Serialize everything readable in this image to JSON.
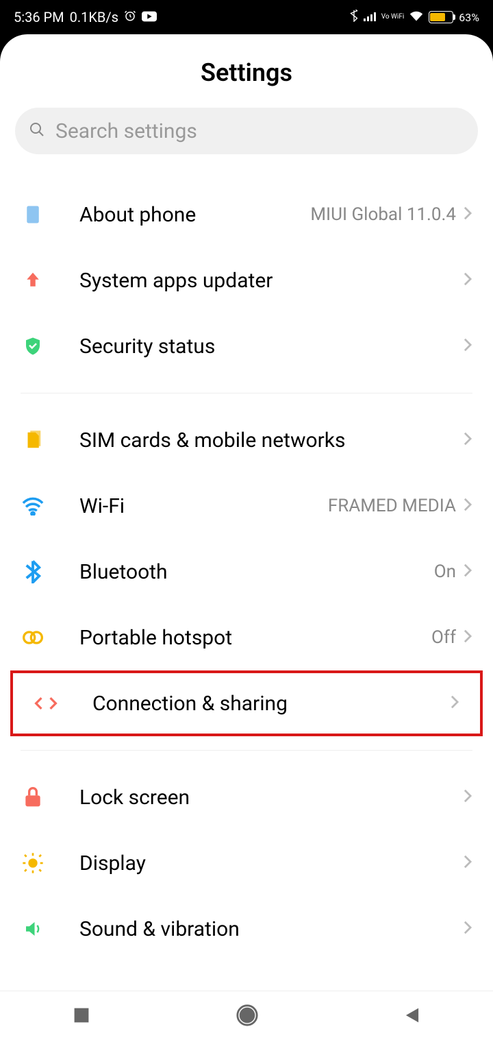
{
  "status": {
    "time": "5:36 PM",
    "data_rate": "0.1KB/s",
    "battery_pct": "63%",
    "vowifi": "Vo WiFi"
  },
  "header": {
    "title": "Settings"
  },
  "search": {
    "placeholder": "Search settings"
  },
  "sections": [
    {
      "items": [
        {
          "icon": "phone-icon",
          "label": "About phone",
          "value": "MIUI Global 11.0.4",
          "color": "#8ec5f1"
        },
        {
          "icon": "arrow-up-icon",
          "label": "System apps updater",
          "value": "",
          "color": "#f76c5e"
        },
        {
          "icon": "shield-check-icon",
          "label": "Security status",
          "value": "",
          "color": "#3dd37a"
        }
      ]
    },
    {
      "items": [
        {
          "icon": "sim-icon",
          "label": "SIM cards & mobile networks",
          "value": "",
          "color": "#f5b800"
        },
        {
          "icon": "wifi-icon",
          "label": "Wi-Fi",
          "value": "FRAMED MEDIA",
          "color": "#1e9df1"
        },
        {
          "icon": "bluetooth-icon",
          "label": "Bluetooth",
          "value": "On",
          "color": "#1e9df1"
        },
        {
          "icon": "hotspot-icon",
          "label": "Portable hotspot",
          "value": "Off",
          "color": "#f5b800"
        },
        {
          "icon": "connection-icon",
          "label": "Connection & sharing",
          "value": "",
          "color": "#f76c5e"
        }
      ]
    },
    {
      "items": [
        {
          "icon": "lock-icon",
          "label": "Lock screen",
          "value": "",
          "color": "#f76c5e"
        },
        {
          "icon": "sun-icon",
          "label": "Display",
          "value": "",
          "color": "#f5b800"
        },
        {
          "icon": "sound-icon",
          "label": "Sound & vibration",
          "value": "",
          "color": "#3dd37a"
        }
      ]
    }
  ]
}
